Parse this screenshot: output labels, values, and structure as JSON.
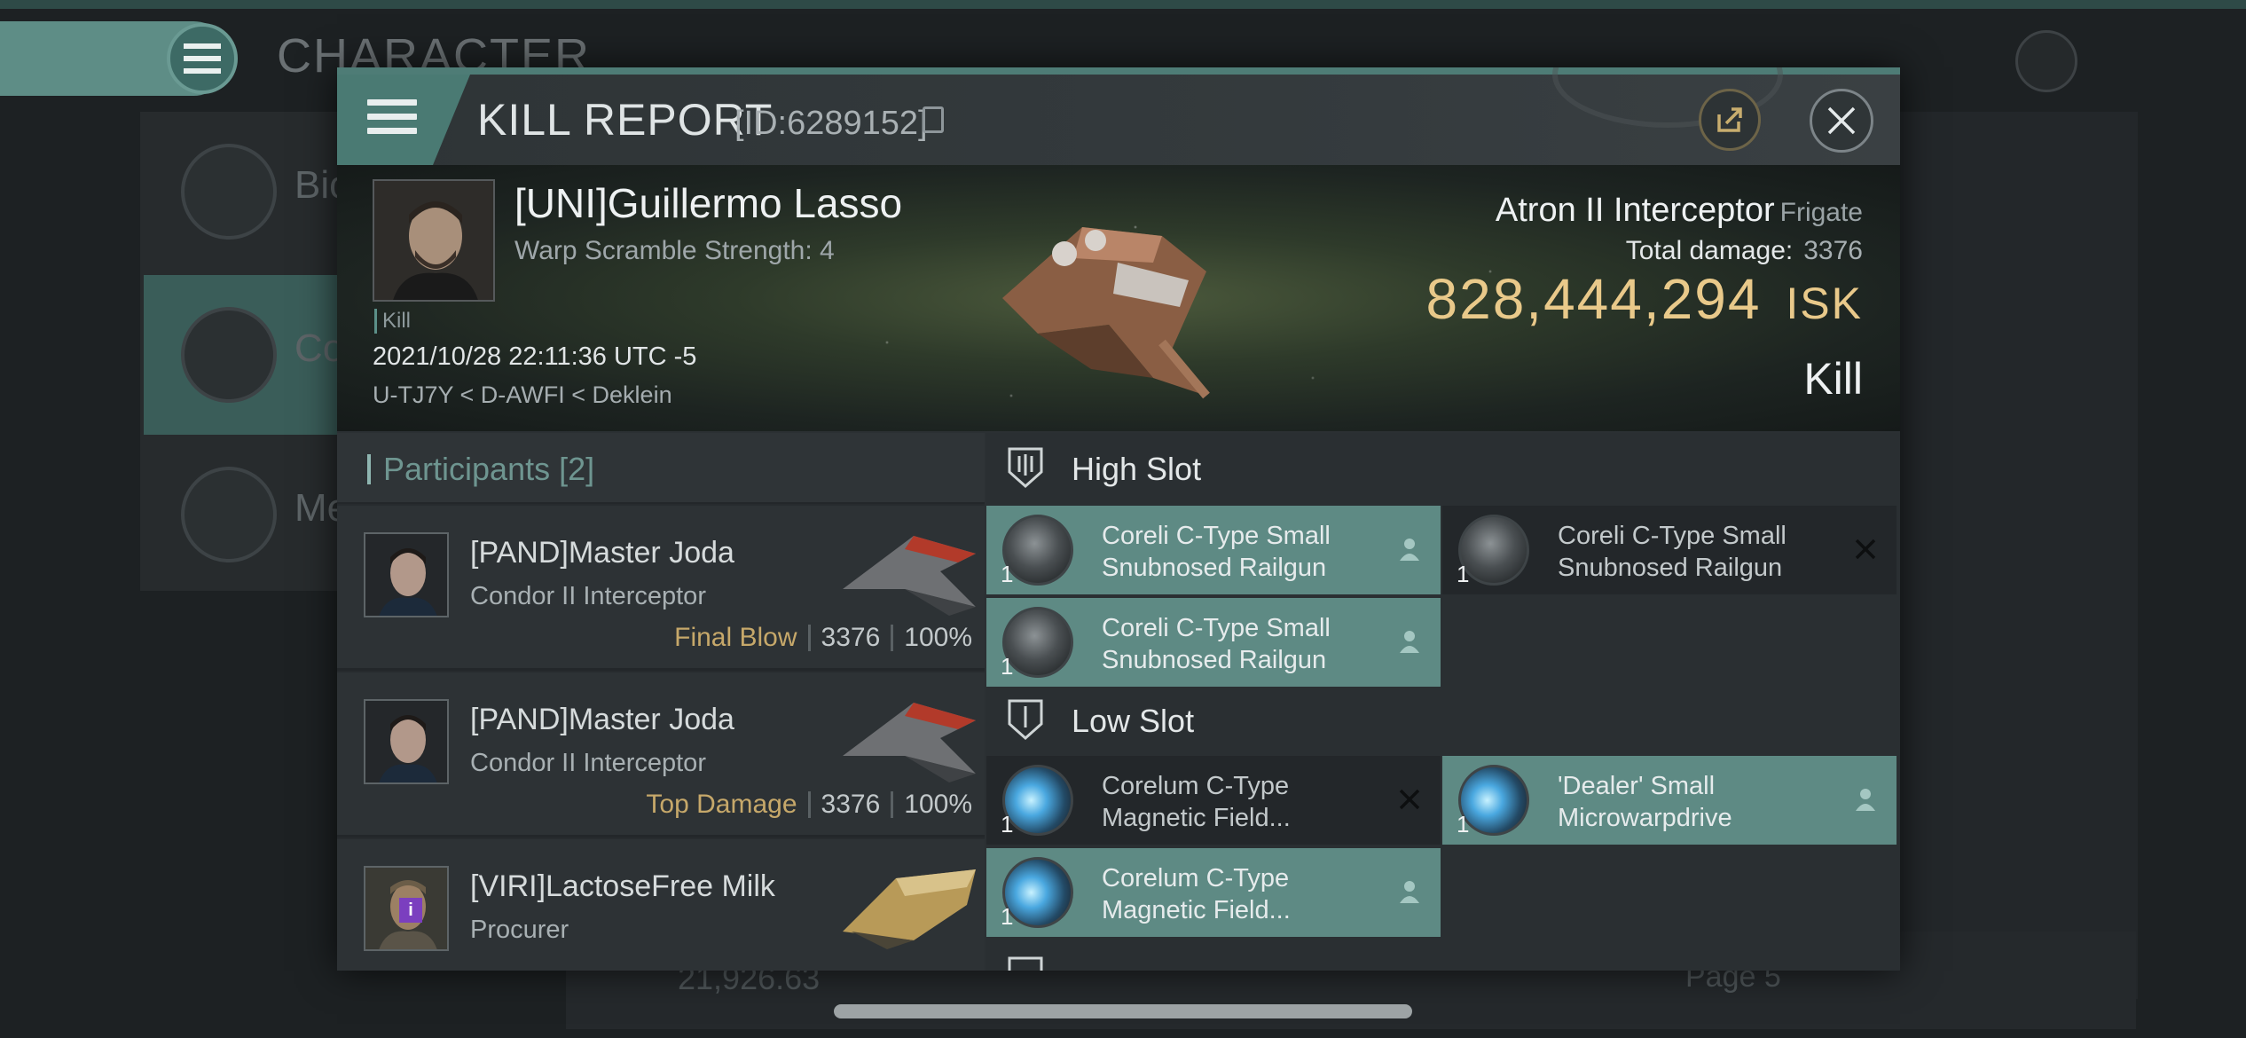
{
  "background": {
    "title": "CHARACTER",
    "panel_items": [
      "Bio",
      "Co",
      "Me"
    ],
    "isk": "21,926.63",
    "page": "Page 5"
  },
  "modal": {
    "title": "KILL REPORT",
    "id": "[ID:6289152]"
  },
  "victim": {
    "name": "[UNI]Guillermo Lasso",
    "scramble": "Warp Scramble Strength: 4",
    "tag": "Kill",
    "datetime": "2021/10/28 22:11:36 UTC -5",
    "location": "U-TJ7Y < D-AWFI < Deklein",
    "ship": "Atron II Interceptor",
    "ship_class": "Frigate",
    "total_damage_label": "Total damage:",
    "total_damage": "3376",
    "isk_value": "828,444,294",
    "isk_unit": "ISK",
    "result": "Kill"
  },
  "participants": {
    "title": "Participants [2]",
    "rows": [
      {
        "name": "[PAND]Master Joda",
        "ship": "Condor II Interceptor",
        "role": "Final Blow",
        "damage": "3376",
        "percent": "100%"
      },
      {
        "name": "[PAND]Master Joda",
        "ship": "Condor II Interceptor",
        "role": "Top Damage",
        "damage": "3376",
        "percent": "100%"
      },
      {
        "name": "[VIRI]LactoseFree Milk",
        "ship": "Procurer"
      }
    ]
  },
  "fitting": {
    "high_slot": {
      "title": "High Slot",
      "items": [
        {
          "name": "Coreli C-Type Small Snubnosed Railgun",
          "qty": "1",
          "status": "dropped"
        },
        {
          "name": "Coreli C-Type Small Snubnosed Railgun",
          "qty": "1",
          "status": "destroyed"
        },
        {
          "name": "Coreli C-Type Small Snubnosed Railgun",
          "qty": "1",
          "status": "dropped"
        }
      ]
    },
    "low_slot": {
      "title": "Low Slot",
      "items": [
        {
          "name": "Corelum C-Type Magnetic Field...",
          "qty": "1",
          "status": "destroyed"
        },
        {
          "name": "'Dealer' Small Microwarpdrive",
          "qty": "1",
          "status": "dropped"
        },
        {
          "name": "Corelum C-Type Magnetic Field...",
          "qty": "1",
          "status": "dropped"
        }
      ]
    }
  },
  "colors": {
    "accent": "#5e8a84",
    "isk": "#e9c98a",
    "role": "#c6a86a"
  }
}
